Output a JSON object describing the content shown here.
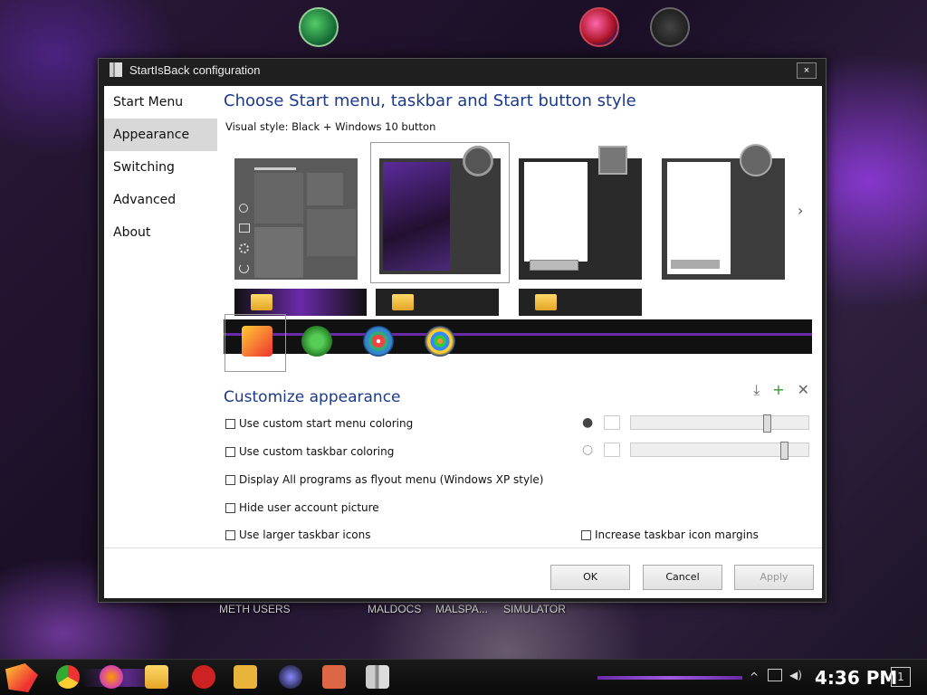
{
  "desktop": {
    "labels": [
      "METH USERS",
      "MALDOCS",
      "MALSPA...",
      "SIMULATOR"
    ]
  },
  "window": {
    "title": "StartIsBack configuration",
    "close_glyph": "×"
  },
  "sidebar": {
    "items": [
      {
        "label": "Start Menu"
      },
      {
        "label": "Appearance"
      },
      {
        "label": "Switching"
      },
      {
        "label": "Advanced"
      },
      {
        "label": "About"
      }
    ],
    "active": "Appearance"
  },
  "main": {
    "heading": "Choose Start menu, taskbar and Start button style",
    "visual_style": "Visual style:  Black + Windows 10 button",
    "customize_heading": "Customize appearance",
    "options": {
      "custom_start_coloring": "Use custom start menu coloring",
      "custom_taskbar_coloring": "Use custom taskbar coloring",
      "flyout_menu": "Display All programs as flyout menu (Windows XP style)",
      "hide_user_picture": "Hide user account picture",
      "larger_icons": "Use larger taskbar icons",
      "increase_margins": "Increase taskbar icon margins"
    },
    "sliders": {
      "start_menu_opacity": 0.78,
      "taskbar_opacity": 0.88
    },
    "tools": {
      "download": "⤓",
      "add": "+",
      "remove": "✕"
    },
    "next_arrow": "›"
  },
  "buttons": {
    "ok": "OK",
    "cancel": "Cancel",
    "apply": "Apply"
  },
  "taskbar": {
    "time": "4:36 PM",
    "notification_count": "1"
  },
  "colors": {
    "heading": "#1b3a8a",
    "accent_purple": "#6a2aa8",
    "window_chrome": "#1f1f1f"
  }
}
